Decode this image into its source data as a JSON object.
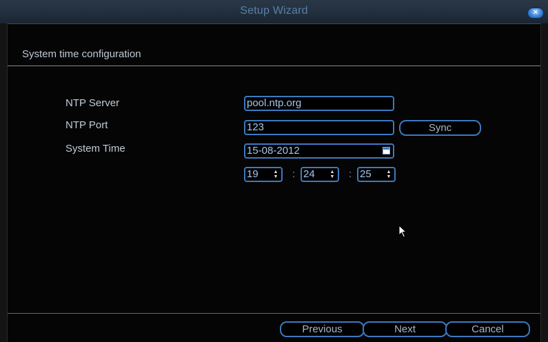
{
  "window": {
    "title": "Setup Wizard",
    "close_icon": "close-icon"
  },
  "section": {
    "title": "System time configuration"
  },
  "form": {
    "ntp_server_label": "NTP Server",
    "ntp_server_value": "pool.ntp.org",
    "ntp_port_label": "NTP Port",
    "ntp_port_value": "123",
    "sync_label": "Sync",
    "system_time_label": "System Time",
    "date_value": "15-08-2012",
    "hour_value": "19",
    "minute_value": "24",
    "second_value": "25",
    "time_separator": ":"
  },
  "footer": {
    "previous_label": "Previous",
    "next_label": "Next",
    "cancel_label": "Cancel"
  },
  "colors": {
    "accent_border": "#3d7ac0",
    "title_text": "#5b7fa6",
    "label_text": "#c2ccd8"
  }
}
